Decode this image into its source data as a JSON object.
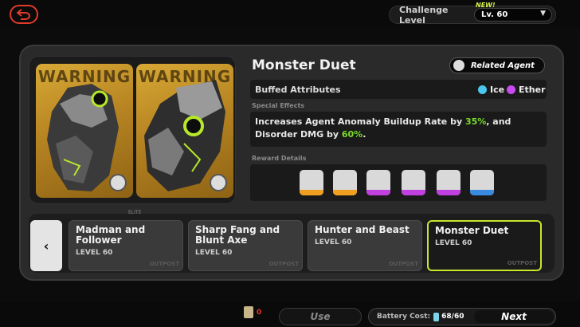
{
  "top_bar": {
    "challenge_label": "Challenge Level",
    "new_badge": "NEW!",
    "level_value": "Lv. 60"
  },
  "card": {
    "warning_text": "WARNING",
    "elite_label": "ELITE"
  },
  "details": {
    "title": "Monster Duet",
    "related_agent_label": "Related Agent",
    "buffed_label": "Buffed Attributes",
    "attributes": [
      {
        "name": "Ice",
        "color": "#4ac8f0"
      },
      {
        "name": "Ether",
        "color": "#c84af0"
      }
    ],
    "special_effects_label": "Special Effects",
    "effect_line1_prefix": "Increases Agent Anomaly Buildup Rate by ",
    "effect_value1": "35%",
    "effect_line1_suffix": ", and",
    "effect_line2_prefix": "Disorder DMG by ",
    "effect_value2": "60%",
    "effect_line2_suffix": ".",
    "reward_label": "Reward Details",
    "rewards": [
      {
        "icon": "reward-icon-1",
        "color": "#f0a020"
      },
      {
        "icon": "reward-icon-2",
        "color": "#f0a020"
      },
      {
        "icon": "reward-icon-3",
        "color": "#c040e0"
      },
      {
        "icon": "reward-icon-4",
        "color": "#c040e0"
      },
      {
        "icon": "reward-icon-5",
        "color": "#c040e0"
      },
      {
        "icon": "reward-icon-6",
        "color": "#3a8ae0"
      }
    ]
  },
  "stages": [
    {
      "name": "Madman and Follower",
      "level": "LEVEL 60",
      "watermark": "OUTPOST"
    },
    {
      "name": "Sharp Fang and Blunt Axe",
      "level": "LEVEL 60",
      "watermark": "OUTPOST"
    },
    {
      "name": "Hunter and Beast",
      "level": "LEVEL 60",
      "watermark": "OUTPOST"
    },
    {
      "name": "Monster Duet",
      "level": "LEVEL 60",
      "watermark": "OUTPOST"
    }
  ],
  "selector": {
    "left_arrow": "‹"
  },
  "bottom_bar": {
    "coin_count": "0",
    "use_label": "Use",
    "battery_label": "Battery Cost:",
    "battery_value": "68/60",
    "next_label": "Next"
  },
  "colors": {
    "accent_green": "#c9e52e",
    "highlight_green": "#7bdc2a",
    "back_red": "#e03a2a"
  }
}
